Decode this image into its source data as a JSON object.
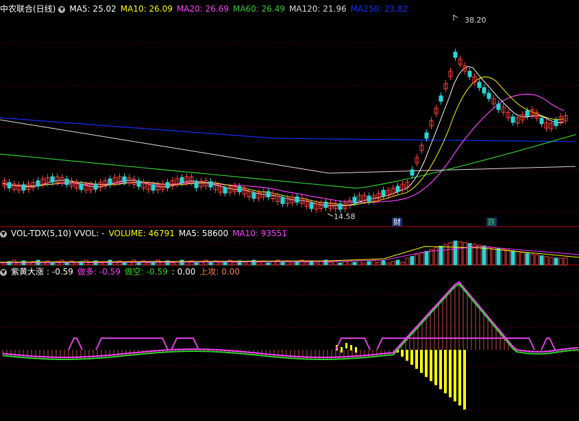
{
  "colors": {
    "bg": "#000000",
    "grid": "#8b0000",
    "up": "#ff4040",
    "down": "#2ad4d4",
    "white": "#ffffff",
    "yellow": "#ffff00",
    "magenta": "#ff40ff",
    "green": "#30d030",
    "blue": "#1030ff",
    "orange": "#ff7f3f",
    "purple": "#e040e0"
  },
  "main": {
    "stock": "中农联合(日线)",
    "ma": [
      {
        "label": "MA5: 25.02",
        "color": "#ffffff"
      },
      {
        "label": "MA10: 26.09",
        "color": "#ffff00"
      },
      {
        "label": "MA20: 26.69",
        "color": "#ff40ff"
      },
      {
        "label": "MA60: 26.49",
        "color": "#30d030"
      },
      {
        "label": "MA120: 21.96",
        "color": "#dddddd"
      },
      {
        "label": "MA250: 23.82",
        "color": "#1030ff"
      }
    ],
    "high_label": "38.20",
    "low_label": "14.58",
    "tags": [
      {
        "text": "财",
        "color": "#ffffff"
      },
      {
        "text": "跌",
        "color": "#30d030"
      }
    ]
  },
  "volume": {
    "name": "VOL-TDX(5,10)",
    "items": [
      {
        "label": "VVOL: -",
        "color": "#ffffff"
      },
      {
        "label": "VOLUME: 46791",
        "color": "#ffff00"
      },
      {
        "label": "MA5: 58600",
        "color": "#ffffff"
      },
      {
        "label": "MA10: 93551",
        "color": "#ff40ff"
      }
    ]
  },
  "indicator": {
    "name": "紫黄大涨",
    "items": [
      {
        "label": ": -0.59",
        "color": "#ffffff"
      },
      {
        "label": "做多: -0.59",
        "color": "#ff40ff"
      },
      {
        "label": "做空: -0.59",
        "color": "#30d030"
      },
      {
        "label": ": 0.00",
        "color": "#ffffff"
      },
      {
        "label": "上攻: 0.00",
        "color": "#ff7f3f"
      }
    ]
  }
}
